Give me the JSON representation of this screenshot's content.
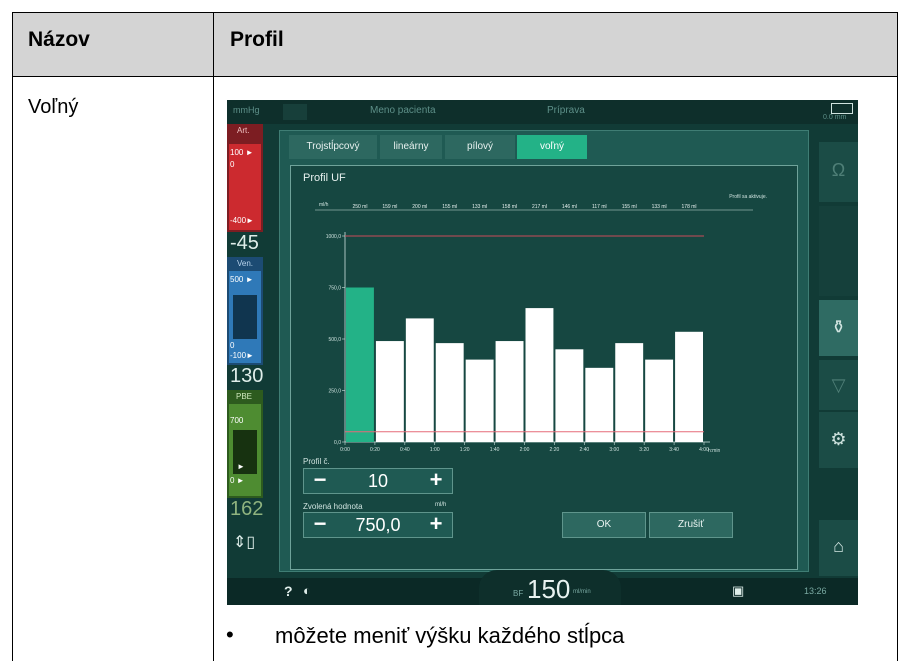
{
  "table": {
    "header_col1": "Názov",
    "header_col2": "Profil",
    "row_name": "Voľný",
    "note": "môžete meniť výšku každého stĺpca"
  },
  "screen": {
    "top_left": "mmHg",
    "patient": "Meno pacienta",
    "phase": "Príprava",
    "top_right_value": "0.0",
    "top_right_unit": "mm",
    "left_panel": {
      "art_label": "Art.",
      "art_top": "100 ►",
      "art_zero": "0",
      "art_low": "-400►",
      "art_value": "-45",
      "ven_label": "Ven.",
      "ven_top": "500 ►",
      "ven_zero": "0",
      "ven_low": "-100►",
      "ven_value": "130",
      "pbe_label": "PBE",
      "pbe_top": "700",
      "pbe_arrow": "►",
      "pbe_low": "0 ►",
      "pbe_value": "162"
    },
    "tabs": [
      {
        "label": "Trojstĺpcový",
        "active": false
      },
      {
        "label": "lineárny",
        "active": false
      },
      {
        "label": "pílový",
        "active": false
      },
      {
        "label": "voľný",
        "active": true
      }
    ],
    "dialog_title": "Profil UF",
    "chart_note": "Profil sa aktivuje.",
    "profile_no_label": "Profil č.",
    "profile_no_value": "10",
    "selected_label": "Zvolená hodnota",
    "selected_unit": "ml/h",
    "selected_value": "750,0",
    "ok_label": "OK",
    "cancel_label": "Zrušiť",
    "bf_label": "BF",
    "bf_value": "150",
    "bf_unit": "ml/min",
    "time": "13:26",
    "help_symbol": "?",
    "accent": "#23b287"
  },
  "chart_data": {
    "type": "bar",
    "ylabel": "ml/h",
    "xlabel": "h:min",
    "ylim": [
      0,
      1000
    ],
    "yticks": [
      "0,0",
      "250,0",
      "500,0",
      "750,0",
      "1000,0"
    ],
    "ytick_values": [
      0,
      250,
      500,
      750,
      1000
    ],
    "categories": [
      "0:00",
      "0:20",
      "0:40",
      "1:00",
      "1:20",
      "1:40",
      "2:00",
      "2:20",
      "2:40",
      "3:00",
      "3:20",
      "3:40",
      "4:00"
    ],
    "values": [
      750,
      490,
      600,
      480,
      400,
      490,
      650,
      450,
      360,
      480,
      400,
      535
    ],
    "volumes": [
      "250 ml",
      "159 ml",
      "200 ml",
      "155 ml",
      "133 ml",
      "158 ml",
      "217 ml",
      "146 ml",
      "117 ml",
      "155 ml",
      "133 ml",
      "178 ml"
    ],
    "selected_index": 0,
    "upper_limit": 1000,
    "lower_limit": 50
  }
}
